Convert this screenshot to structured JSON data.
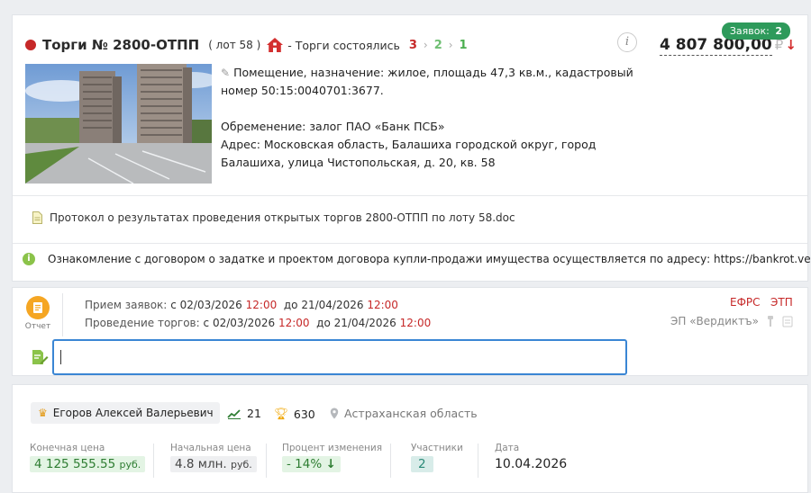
{
  "lot": {
    "bids_label": "Заявок:",
    "bids_count": "2",
    "title": "Торги № 2800-ОТПП",
    "lot_number": "( лот 58 )",
    "status": "- Торги состоялись",
    "steps": [
      "3",
      "2",
      "1"
    ],
    "info_icon": "i",
    "price": "4 807 800,00",
    "currency": "₽",
    "description_line1": "Помещение, назначение: жилое, площадь 47,3 кв.м., кадастровый номер 50:15:0040701:3677.",
    "encumbrance": "Обременение: залог ПАО «Банк ПСБ»",
    "address": "Адрес: Московская область, Балашиха городской округ, город Балашиха, улица Чистопольская, д. 20, кв. 58",
    "document": "Протокол о результатах проведения открытых торгов 2800-ОТПП по лоту 58.doc",
    "notice": "Ознакомление с договором о задатке и проектом договора купли-продажи имущества осуществляется по адресу: https://bankrot.ver..."
  },
  "schedule": {
    "report_label": "Отчет",
    "applications_label": "Прием заявок:",
    "bidding_label": "Проведение торгов:",
    "from": "с",
    "to": "до",
    "app_from_date": "02/03/2026",
    "app_from_time": "12:00",
    "app_to_date": "21/04/2026",
    "app_to_time": "12:00",
    "bid_from_date": "02/03/2026",
    "bid_from_time": "12:00",
    "bid_to_date": "21/04/2026",
    "bid_to_time": "12:00",
    "efrs": "ЕФРС",
    "etp": "ЭТП",
    "platform": "ЭП «Вердиктъ»",
    "note_value": ""
  },
  "result": {
    "winner": "Егоров Алексей Валерьевич",
    "trend_count": "21",
    "trophy_count": "630",
    "region": "Астраханская область",
    "final_price_label": "Конечная цена",
    "final_price": "4 125 555.55",
    "final_price_unit": "руб.",
    "start_price_label": "Начальная цена",
    "start_price": "4.8 млн.",
    "start_price_unit": "руб.",
    "change_label": "Процент изменения",
    "change_value": "- 14%",
    "participants_label": "Участники",
    "participants": "2",
    "date_label": "Дата",
    "date": "10.04.2026"
  },
  "icons": {
    "status": "house-icon",
    "price_trend": "arrow-down-icon",
    "doc": "document-icon",
    "notice": "info-icon",
    "report": "report-icon",
    "note": "edit-note-icon",
    "winner": "crown-icon",
    "stats": [
      "trend-icon",
      "trophy-icon",
      "location-icon"
    ]
  },
  "colors": {
    "accent_red": "#c62828",
    "badge_green": "#2e9a5b",
    "input_border": "#3a86d4",
    "report_orange": "#f5a623"
  }
}
